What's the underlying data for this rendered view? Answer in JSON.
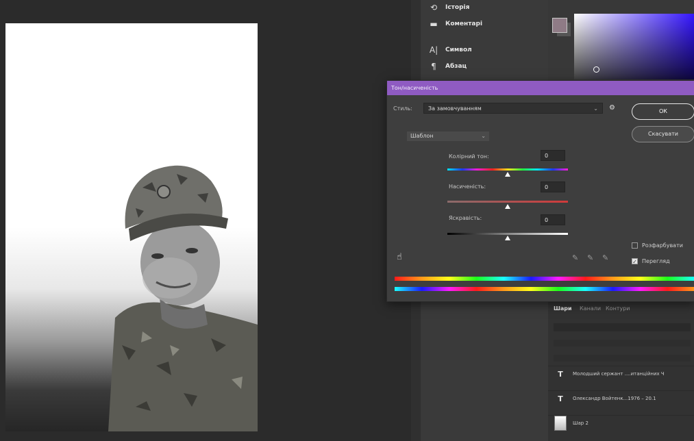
{
  "panel_strip": {
    "items": [
      {
        "label": "Історія",
        "icon": "history-icon"
      },
      {
        "label": "Коментарі",
        "icon": "comment-icon"
      },
      {
        "label": "Символ",
        "icon": "character-icon"
      },
      {
        "label": "Абзац",
        "icon": "paragraph-icon"
      }
    ]
  },
  "dialog": {
    "title": "Тон/насиченість",
    "preset_label": "Стиль:",
    "preset_value": "За замовчуванням",
    "ok_label": "ОК",
    "cancel_label": "Скасувати",
    "channel_value": "Шаблон",
    "hue": {
      "label": "Колірний тон:",
      "value": "0"
    },
    "saturation": {
      "label": "Насиченість:",
      "value": "0"
    },
    "lightness": {
      "label": "Яскравість:",
      "value": "0"
    },
    "colorize_label": "Розфарбувати",
    "colorize_checked": false,
    "preview_label": "Перегляд",
    "preview_checked": true
  },
  "layers_panel": {
    "tabs": [
      "Шари",
      "Канали",
      "Контури"
    ],
    "active_tab": "Шари",
    "layers": [
      {
        "name": "Молодший сержант ....итанційних Ч",
        "type": "text"
      },
      {
        "name": "Олександр Войтенк...1976 – 20.1",
        "type": "text"
      },
      {
        "name": "Шар 2",
        "type": "image"
      }
    ]
  },
  "colors": {
    "dialog_title_bar": "#8f5bc2",
    "panel_bg": "#3a3a3a",
    "canvas_bg": "#2b2b2b",
    "color_field_hue": "#3516ff",
    "swatch": "#8f7b86"
  }
}
